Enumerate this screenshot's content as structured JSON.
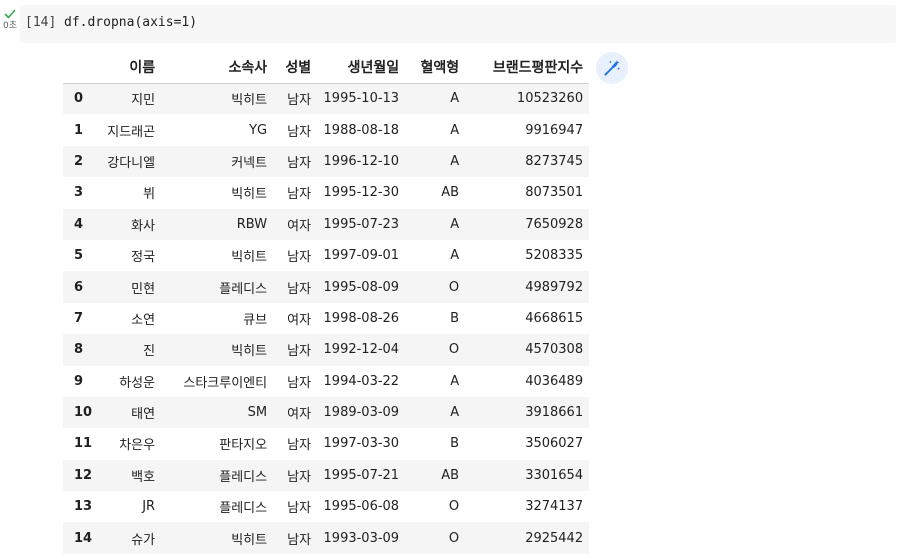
{
  "cell": {
    "exec_time": "0초",
    "exec_count": "[14]",
    "code": "df.dropna(axis=1)"
  },
  "colors": {
    "success": "#34a853",
    "wand": "#1a73e8",
    "row_stripe": "#f5f5f5"
  },
  "table": {
    "columns": [
      "이름",
      "소속사",
      "성별",
      "생년월일",
      "혈액형",
      "브랜드평판지수"
    ],
    "rows": [
      {
        "index": "0",
        "cells": [
          "지민",
          "빅히트",
          "남자",
          "1995-10-13",
          "A",
          "10523260"
        ]
      },
      {
        "index": "1",
        "cells": [
          "지드래곤",
          "YG",
          "남자",
          "1988-08-18",
          "A",
          "9916947"
        ]
      },
      {
        "index": "2",
        "cells": [
          "강다니엘",
          "커넥트",
          "남자",
          "1996-12-10",
          "A",
          "8273745"
        ]
      },
      {
        "index": "3",
        "cells": [
          "뷔",
          "빅히트",
          "남자",
          "1995-12-30",
          "AB",
          "8073501"
        ]
      },
      {
        "index": "4",
        "cells": [
          "화사",
          "RBW",
          "여자",
          "1995-07-23",
          "A",
          "7650928"
        ]
      },
      {
        "index": "5",
        "cells": [
          "정국",
          "빅히트",
          "남자",
          "1997-09-01",
          "A",
          "5208335"
        ]
      },
      {
        "index": "6",
        "cells": [
          "민현",
          "플레디스",
          "남자",
          "1995-08-09",
          "O",
          "4989792"
        ]
      },
      {
        "index": "7",
        "cells": [
          "소연",
          "큐브",
          "여자",
          "1998-08-26",
          "B",
          "4668615"
        ]
      },
      {
        "index": "8",
        "cells": [
          "진",
          "빅히트",
          "남자",
          "1992-12-04",
          "O",
          "4570308"
        ]
      },
      {
        "index": "9",
        "cells": [
          "하성운",
          "스타크루이엔티",
          "남자",
          "1994-03-22",
          "A",
          "4036489"
        ]
      },
      {
        "index": "10",
        "cells": [
          "태연",
          "SM",
          "여자",
          "1989-03-09",
          "A",
          "3918661"
        ]
      },
      {
        "index": "11",
        "cells": [
          "차은우",
          "판타지오",
          "남자",
          "1997-03-30",
          "B",
          "3506027"
        ]
      },
      {
        "index": "12",
        "cells": [
          "백호",
          "플레디스",
          "남자",
          "1995-07-21",
          "AB",
          "3301654"
        ]
      },
      {
        "index": "13",
        "cells": [
          "JR",
          "플레디스",
          "남자",
          "1995-06-08",
          "O",
          "3274137"
        ]
      },
      {
        "index": "14",
        "cells": [
          "슈가",
          "빅히트",
          "남자",
          "1993-03-09",
          "O",
          "2925442"
        ]
      }
    ]
  }
}
